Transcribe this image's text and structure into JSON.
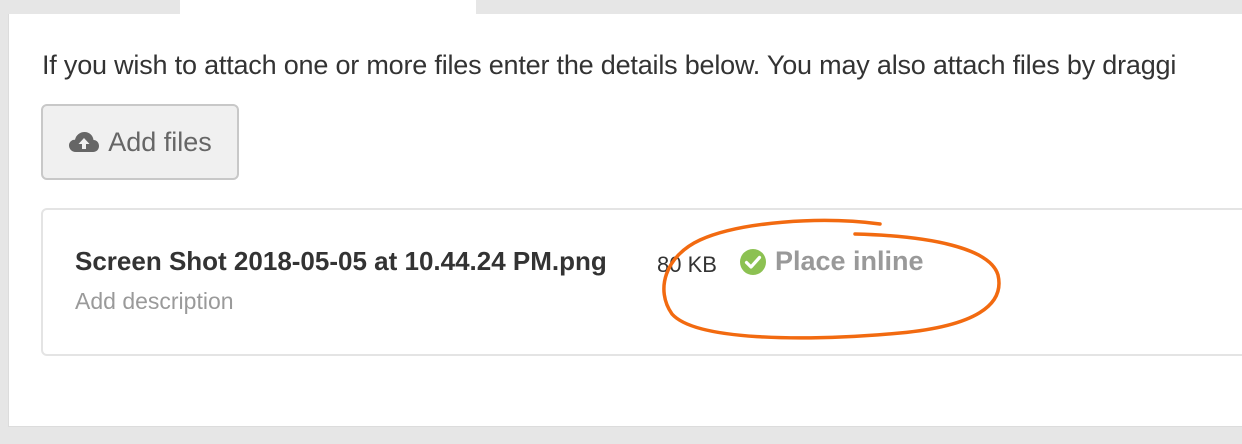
{
  "attachments": {
    "intro_text": "If you wish to attach one or more files enter the details below. You may also attach files by draggi",
    "add_button_label": "Add files",
    "add_button_icon": "cloud-upload-icon",
    "file": {
      "name": "Screen Shot 2018-05-05 at 10.44.24 PM.png",
      "size": "80 KB",
      "place_inline_label": "Place inline",
      "place_inline_icon": "check-circle-icon",
      "add_description_label": "Add description"
    }
  },
  "colors": {
    "annotation": "#f26a10",
    "check": "#8cc152"
  }
}
